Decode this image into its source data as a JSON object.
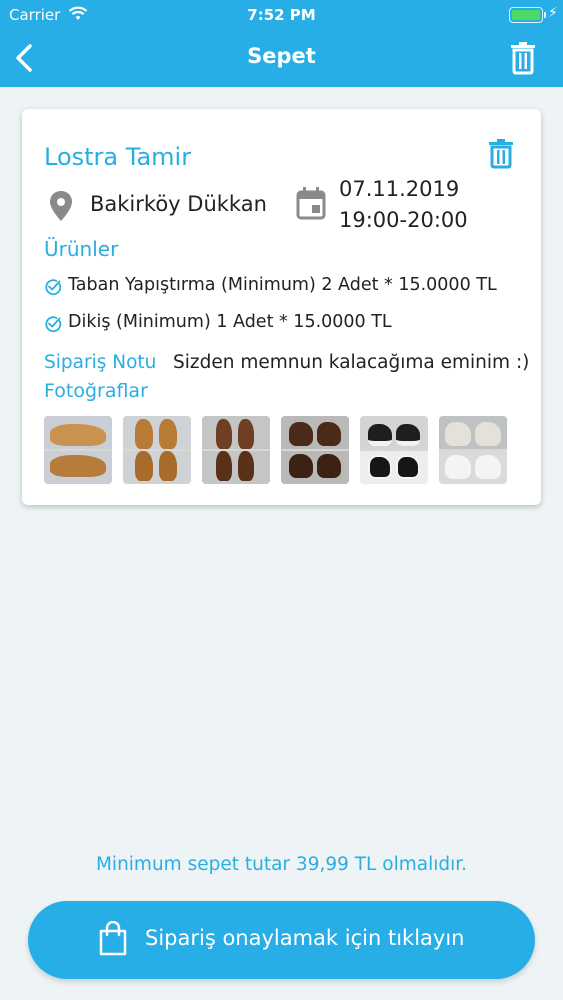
{
  "status_bar": {
    "carrier": "Carrier",
    "time": "7:52 PM",
    "battery_level": 1.0
  },
  "nav": {
    "title": "Sepet",
    "back_icon": "chevron-left-icon",
    "trash_icon": "trash-icon"
  },
  "order": {
    "shop_name": "Lostra Tamir",
    "location": "Bakirköy Dükkan",
    "date": "07.11.2019",
    "time_slot": "19:00-20:00",
    "products_title": "Ürünler",
    "products": [
      {
        "label": "Taban Yapıştırma (Minimum) 2 Adet * 15.0000 TL"
      },
      {
        "label": "Dikiş (Minimum) 1 Adet * 15.0000 TL"
      }
    ],
    "note_label": "Sipariş Notu",
    "note_text": "Sizden memnun kalacağıma eminim :)",
    "photos_label": "Fotoğraflar",
    "photo_count": 6
  },
  "footer": {
    "min_note": "Minimum sepet tutar 39,99 TL olmalıdır.",
    "confirm_label": "Sipariş onaylamak için tıklayın"
  },
  "colors": {
    "accent": "#27aee6",
    "text": "#222222",
    "background": "#eef4f6"
  }
}
